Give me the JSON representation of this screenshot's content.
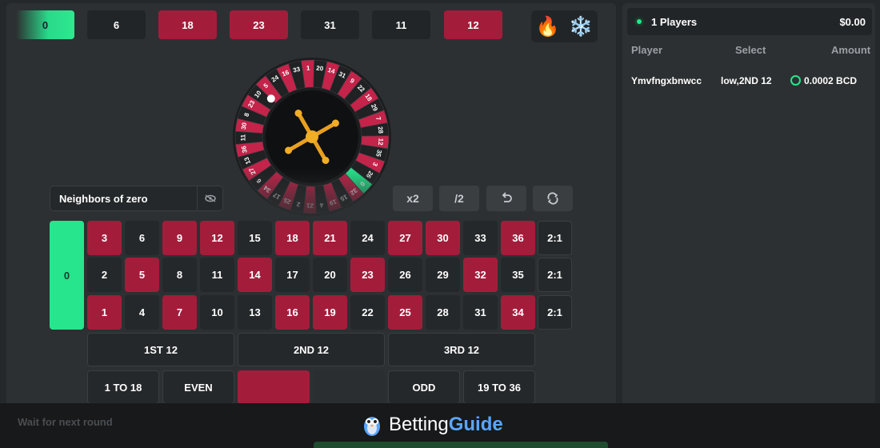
{
  "history": [
    {
      "value": "0",
      "color": "green"
    },
    {
      "value": "6",
      "color": "black"
    },
    {
      "value": "18",
      "color": "red"
    },
    {
      "value": "23",
      "color": "red"
    },
    {
      "value": "31",
      "color": "black"
    },
    {
      "value": "11",
      "color": "black"
    },
    {
      "value": "12",
      "color": "red"
    }
  ],
  "hot_cold": {
    "hot_icon": "🔥",
    "cold_icon": "❄️"
  },
  "wheel": {
    "numbers_top_arc": [
      "33",
      "1",
      "20",
      "14",
      "31",
      "9",
      "22",
      "18",
      "29",
      "7",
      "28",
      "12",
      "35",
      "3",
      "26",
      "0"
    ],
    "numbers_left_arc": [
      "16",
      "24",
      "5",
      "10",
      "23",
      "8",
      "30",
      "11",
      "36",
      "13",
      "27",
      "6",
      "34",
      "17"
    ],
    "numbers_bottom_faded": [
      "25",
      "2",
      "21",
      "4",
      "19",
      "15",
      "32"
    ]
  },
  "bet_select": {
    "label": "Neighbors of zero",
    "icon": "settings-icon"
  },
  "controls": {
    "double": "x2",
    "half": "/2",
    "undo_icon": "undo-icon",
    "repeat_icon": "repeat-icon"
  },
  "table": {
    "zero": "0",
    "rows": [
      [
        "3",
        "6",
        "9",
        "12",
        "15",
        "18",
        "21",
        "24",
        "27",
        "30",
        "33",
        "36"
      ],
      [
        "2",
        "5",
        "8",
        "11",
        "14",
        "17",
        "20",
        "23",
        "26",
        "29",
        "32",
        "35"
      ],
      [
        "1",
        "4",
        "7",
        "10",
        "13",
        "16",
        "19",
        "22",
        "25",
        "28",
        "31",
        "34"
      ]
    ],
    "red_numbers": [
      "1",
      "3",
      "5",
      "7",
      "9",
      "12",
      "14",
      "16",
      "18",
      "19",
      "21",
      "23",
      "25",
      "27",
      "30",
      "32",
      "34",
      "36"
    ],
    "column_bets": [
      "2:1",
      "2:1",
      "2:1"
    ],
    "dozens": [
      "1ST 12",
      "2ND 12",
      "3RD 12"
    ],
    "outside": {
      "low": "1 TO 18",
      "even": "EVEN",
      "odd": "ODD",
      "high": "19 TO 36"
    }
  },
  "status": {
    "wait": "Wait for next round"
  },
  "players": {
    "count_label": "1 Players",
    "total": "$0.00",
    "headers": {
      "player": "Player",
      "select": "Select",
      "amount": "Amount"
    },
    "rows": [
      {
        "player": "Ymvfngxbnwcc",
        "select": "low,2ND 12",
        "amount": "0.0002 BCD"
      }
    ]
  },
  "branding": {
    "name_a": "Betting",
    "name_b": "Guide"
  },
  "colors": {
    "red": "#a31d3b",
    "green": "#26e58c",
    "black": "#25282a",
    "panel": "#2d3032",
    "brand_blue": "#5aa6ff"
  }
}
